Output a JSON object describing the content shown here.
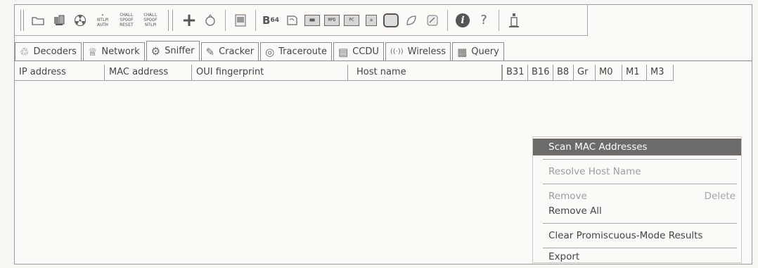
{
  "toolbar": {
    "buttons": [
      {
        "name": "open-icon",
        "glyph": "🗀"
      },
      {
        "name": "sniffer-adapter-icon",
        "glyph": "⚙"
      },
      {
        "name": "radiation-icon",
        "glyph": "☢"
      },
      {
        "name": "ntlm-auth",
        "text": "NTLM\nAUTH"
      },
      {
        "name": "chall-spoof-reset",
        "text": "CHALL\nSPOOF\nRESET"
      },
      {
        "name": "chall-spoof-ntlm",
        "text": "CHALL\nSPOOF\nNTLM"
      }
    ],
    "b64_label": "B",
    "b64_sub": "64",
    "help_glyph": "?",
    "info_glyph": "i",
    "plus_glyph": "+"
  },
  "tabs": [
    {
      "label": "Decoders",
      "icon": "decoders-icon",
      "glyph": "♲"
    },
    {
      "label": "Network",
      "icon": "network-icon",
      "glyph": "♕"
    },
    {
      "label": "Sniffer",
      "icon": "sniffer-icon",
      "glyph": "⚙"
    },
    {
      "label": "Cracker",
      "icon": "cracker-icon",
      "glyph": "✎"
    },
    {
      "label": "Traceroute",
      "icon": "traceroute-icon",
      "glyph": "◎"
    },
    {
      "label": "CCDU",
      "icon": "ccdu-icon",
      "glyph": "▤"
    },
    {
      "label": "Wireless",
      "icon": "wireless-icon",
      "glyph": "((·))"
    },
    {
      "label": "Query",
      "icon": "query-icon",
      "glyph": "▦"
    }
  ],
  "table": {
    "columns": [
      "IP address",
      "MAC address",
      "OUI fingerprint",
      "Host name",
      "B31",
      "B16",
      "B8",
      "Gr",
      "M0",
      "M1",
      "M3"
    ]
  },
  "context_menu": {
    "scan": "Scan MAC Addresses",
    "resolve": "Resolve Host Name",
    "remove": "Remove",
    "remove_shortcut": "Delete",
    "remove_all": "Remove All",
    "clear": "Clear Promiscuous-Mode Results",
    "export": "Export"
  }
}
